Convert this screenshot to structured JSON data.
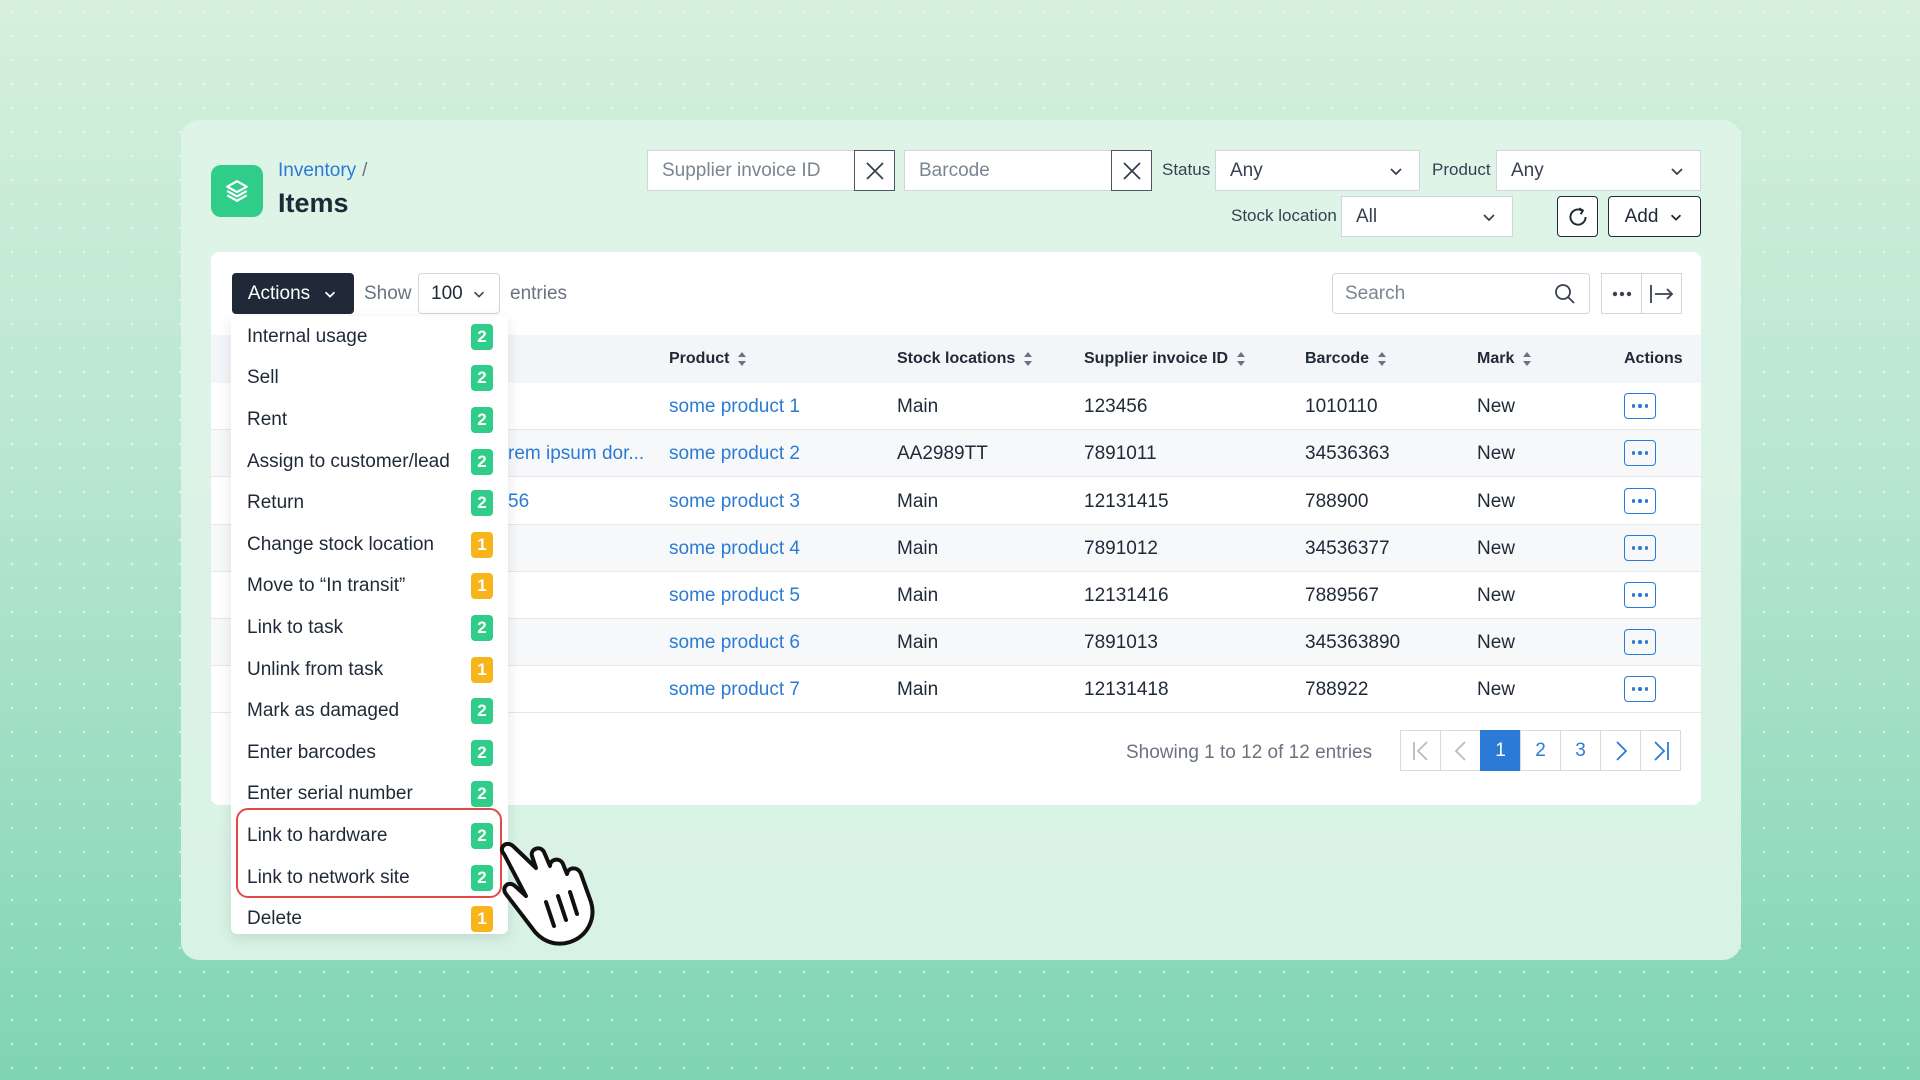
{
  "breadcrumb": {
    "parent": "Inventory",
    "separator": "/"
  },
  "page_title": "Items",
  "filters": {
    "supplier_invoice_placeholder": "Supplier invoice ID",
    "barcode_placeholder": "Barcode",
    "status_label": "Status",
    "status_value": "Any",
    "product_label": "Product",
    "product_value": "Any",
    "stock_location_label": "Stock location",
    "stock_location_value": "All",
    "add_label": "Add"
  },
  "toolbar": {
    "actions_label": "Actions",
    "show_label": "Show",
    "entries_value": "100",
    "entries_label": "entries",
    "search_placeholder": "Search"
  },
  "table": {
    "headers": [
      "Product",
      "Stock locations",
      "Supplier invoice ID",
      "Barcode",
      "Mark",
      "Actions"
    ],
    "rows": [
      {
        "partial": "",
        "product": "some product 1",
        "location": "Main",
        "invoice": "123456",
        "barcode": "1010110",
        "mark": "New"
      },
      {
        "partial": "rem ipsum dor...",
        "product": "some product 2",
        "location": "AA2989TT",
        "invoice": "7891011",
        "barcode": "34536363",
        "mark": "New"
      },
      {
        "partial": "56",
        "product": "some product 3",
        "location": "Main",
        "invoice": "12131415",
        "barcode": "788900",
        "mark": "New"
      },
      {
        "partial": "",
        "product": "some product 4",
        "location": "Main",
        "invoice": "7891012",
        "barcode": "34536377",
        "mark": "New"
      },
      {
        "partial": "",
        "product": "some product 5",
        "location": "Main",
        "invoice": "12131416",
        "barcode": "7889567",
        "mark": "New"
      },
      {
        "partial": "",
        "product": "some product 6",
        "location": "Main",
        "invoice": "7891013",
        "barcode": "345363890",
        "mark": "New"
      },
      {
        "partial": "",
        "product": "some product 7",
        "location": "Main",
        "invoice": "12131418",
        "barcode": "788922",
        "mark": "New"
      }
    ]
  },
  "pagination": {
    "summary": "Showing 1 to 12 of 12 entries",
    "pages": [
      "1",
      "2",
      "3"
    ],
    "current": "1"
  },
  "actions_menu": [
    {
      "label": "Internal usage",
      "count": "2",
      "color": "#2fcc8a"
    },
    {
      "label": "Sell",
      "count": "2",
      "color": "#2fcc8a"
    },
    {
      "label": "Rent",
      "count": "2",
      "color": "#2fcc8a"
    },
    {
      "label": "Assign to customer/lead",
      "count": "2",
      "color": "#2fcc8a"
    },
    {
      "label": "Return",
      "count": "2",
      "color": "#2fcc8a"
    },
    {
      "label": "Change stock location",
      "count": "1",
      "color": "#f8b41b"
    },
    {
      "label": "Move to “In transit”",
      "count": "1",
      "color": "#f8b41b"
    },
    {
      "label": "Link to task",
      "count": "2",
      "color": "#2fcc8a"
    },
    {
      "label": "Unlink from task",
      "count": "1",
      "color": "#f8b41b"
    },
    {
      "label": "Mark as damaged",
      "count": "2",
      "color": "#2fcc8a"
    },
    {
      "label": "Enter barcodes",
      "count": "2",
      "color": "#2fcc8a"
    },
    {
      "label": "Enter serial number",
      "count": "2",
      "color": "#2fcc8a"
    },
    {
      "label": "Link to hardware",
      "count": "2",
      "color": "#2fcc8a"
    },
    {
      "label": "Link to network site",
      "count": "2",
      "color": "#2fcc8a"
    },
    {
      "label": "Delete",
      "count": "1",
      "color": "#f8b41b"
    }
  ],
  "colors": {
    "accent": "#2b7bd6",
    "brand": "#2fcc8a",
    "warning": "#f8b41b",
    "highlight": "#e24a4a"
  }
}
